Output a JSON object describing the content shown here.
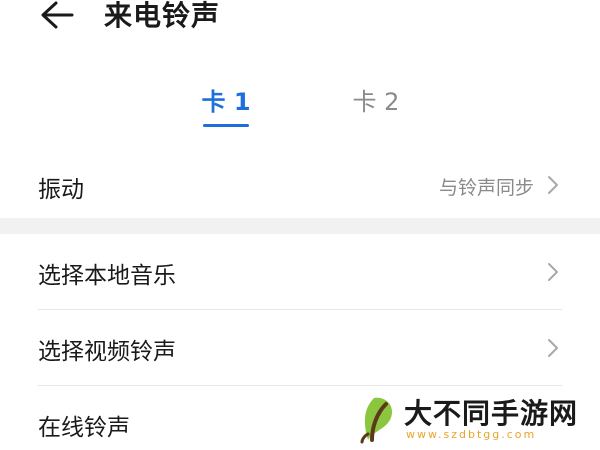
{
  "header": {
    "title": "来电铃声",
    "back_icon": "arrow-left-icon"
  },
  "tabs": [
    {
      "label": "卡 1",
      "selected": true
    },
    {
      "label": "卡 2",
      "selected": false
    }
  ],
  "accent_color": "#1f6fdb",
  "settings": {
    "vibration": {
      "label": "振动",
      "value": "与铃声同步"
    },
    "items": [
      {
        "label": "选择本地音乐"
      },
      {
        "label": "选择视频铃声"
      },
      {
        "label": "在线铃声"
      }
    ]
  },
  "watermark": {
    "brand": "大不同手游网",
    "url": "www.szdbtgg.com",
    "logo_color": "#2c7a33"
  }
}
